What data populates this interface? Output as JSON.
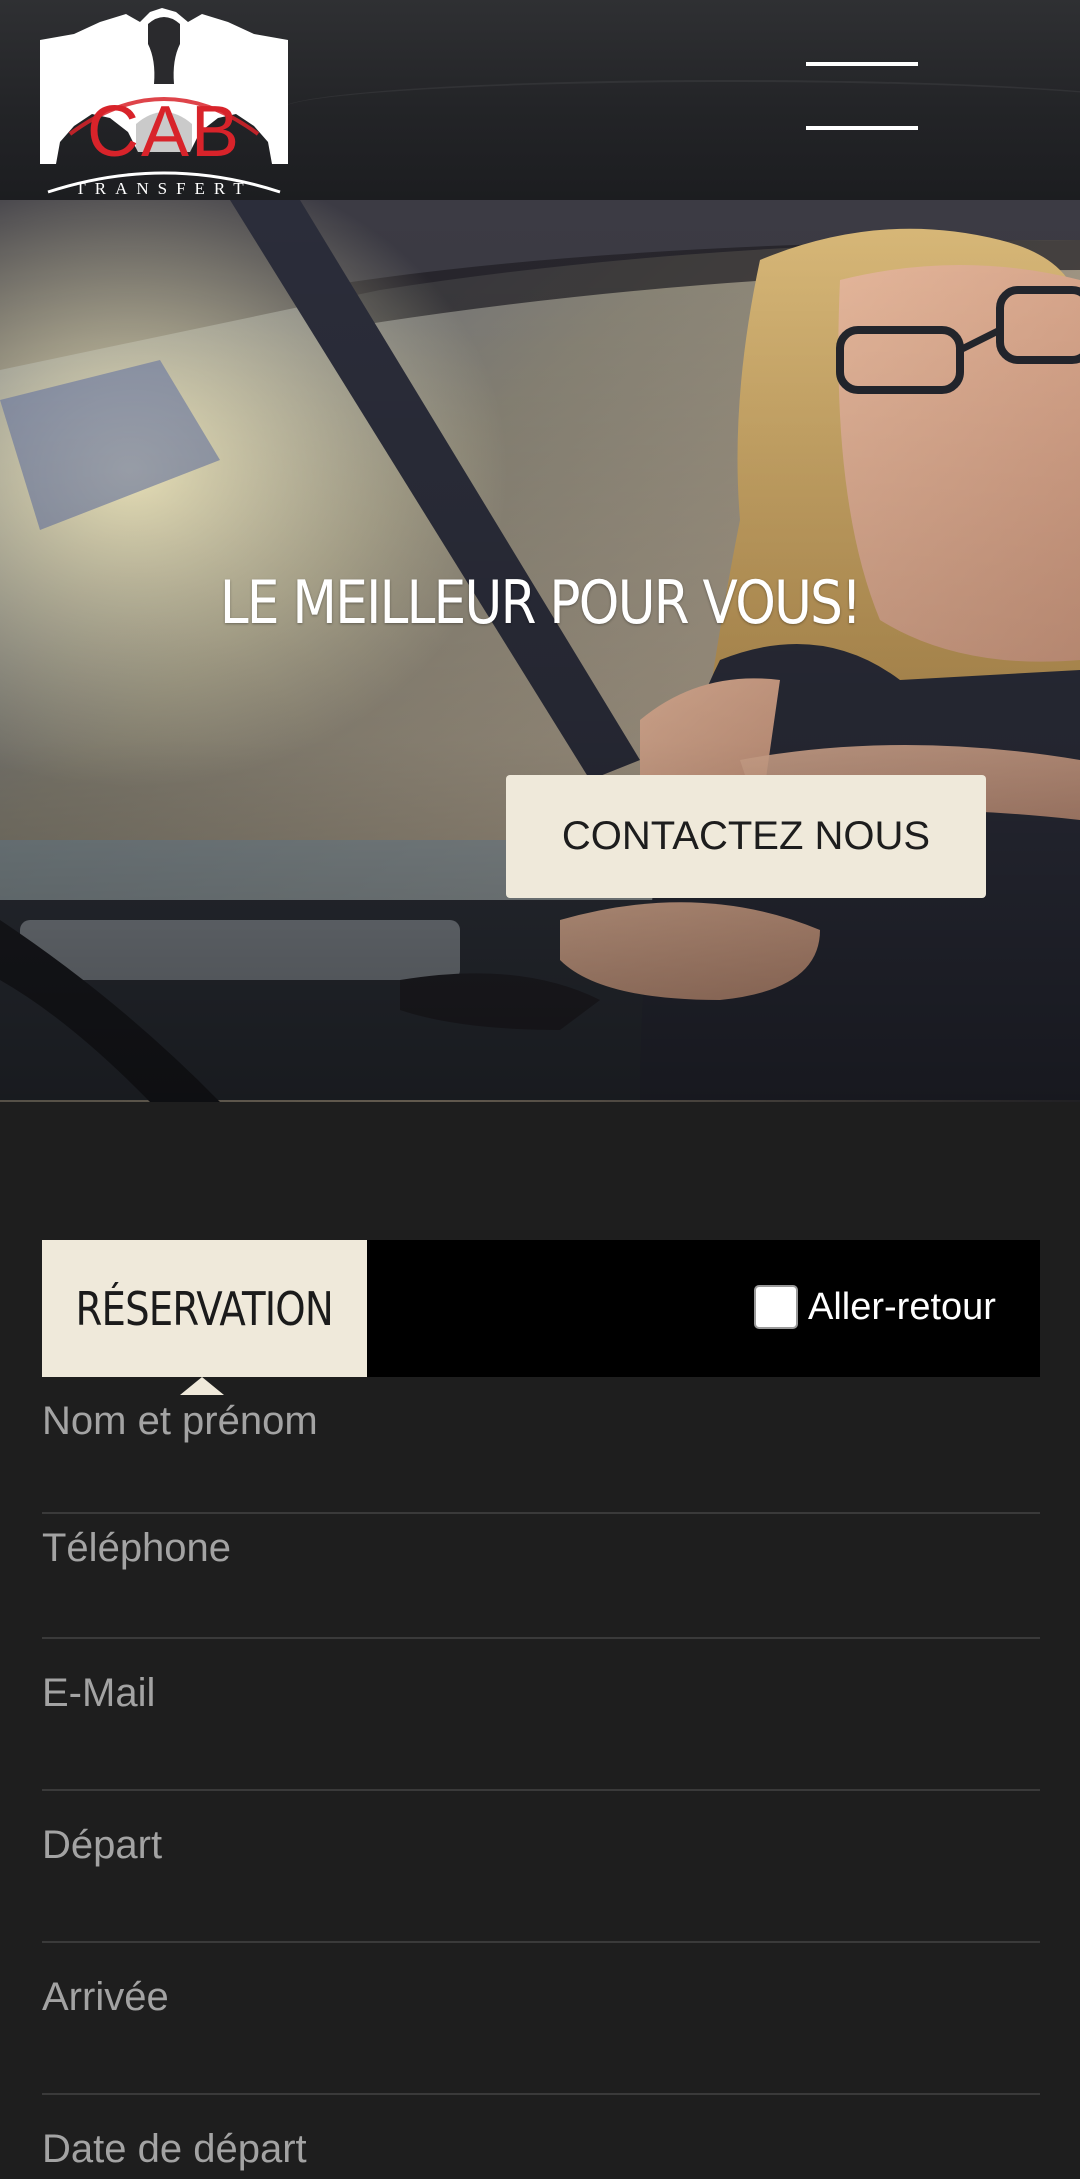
{
  "header": {
    "logo": {
      "brand": "CAB",
      "tagline": "TRANSFERT"
    },
    "menu_icon": "hamburger-icon"
  },
  "hero": {
    "title": "LE MEILLEUR POUR VOUS!",
    "cta_label": "CONTACTEZ NOUS"
  },
  "booking": {
    "tab_label": "RÉSERVATION",
    "roundtrip_label": "Aller-retour",
    "roundtrip_checked": false,
    "fields": [
      {
        "placeholder": "Nom et prénom",
        "value": ""
      },
      {
        "placeholder": "Téléphone",
        "value": ""
      },
      {
        "placeholder": "E-Mail",
        "value": ""
      },
      {
        "placeholder": "Départ",
        "value": ""
      },
      {
        "placeholder": "Arrivée",
        "value": ""
      },
      {
        "placeholder": "Date de départ",
        "value": ""
      }
    ]
  },
  "colors": {
    "background": "#1e1e1e",
    "accent_cream": "#efe9da",
    "brand_red": "#d8232a",
    "tab_bar": "#000000"
  }
}
